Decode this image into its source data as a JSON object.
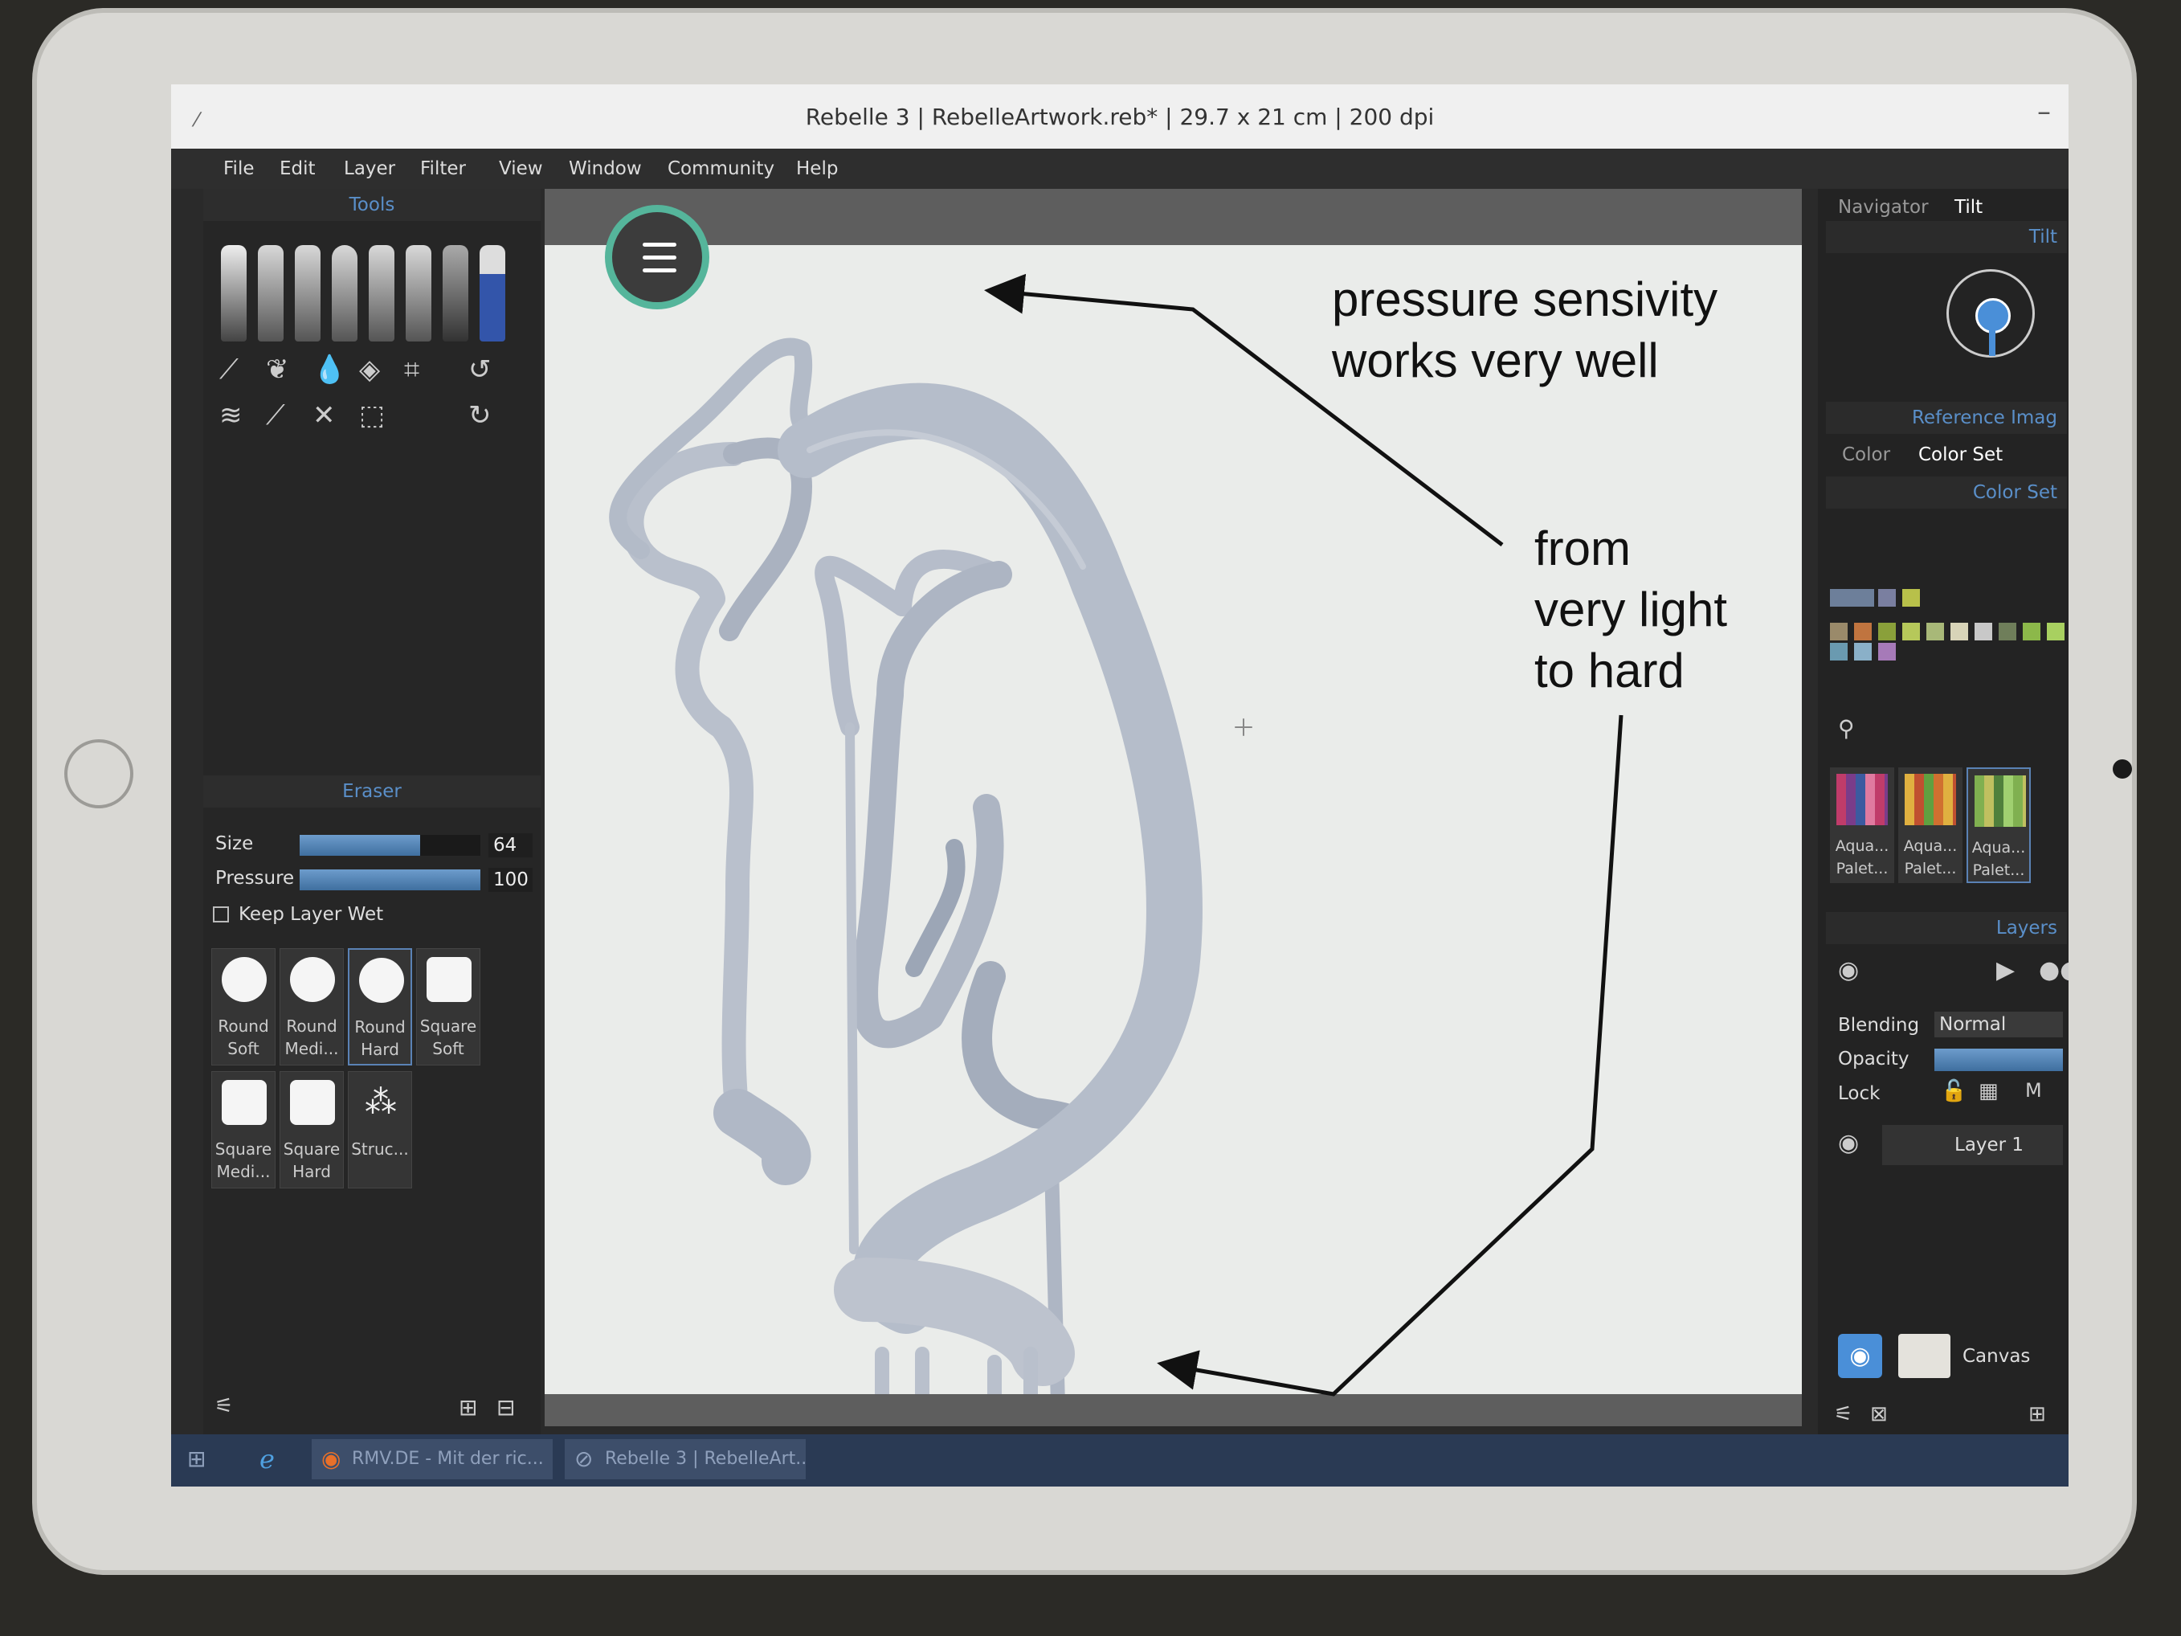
{
  "window": {
    "title": "Rebelle 3 | RebelleArtwork.reb* | 29.7 x 21 cm | 200 dpi",
    "minimize": "–"
  },
  "menu": [
    "File",
    "Edit",
    "Layer",
    "Filter",
    "View",
    "Window",
    "Community",
    "Help"
  ],
  "tools_panel": {
    "title": "Tools"
  },
  "eraser_panel": {
    "title": "Eraser",
    "size_label": "Size",
    "size_value": "64",
    "pressure_label": "Pressure",
    "pressure_value": "100",
    "keep_wet_label": "Keep Layer Wet",
    "presets": [
      {
        "line1": "Round",
        "line2": "Soft"
      },
      {
        "line1": "Round",
        "line2": "Medi..."
      },
      {
        "line1": "Round",
        "line2": "Hard"
      },
      {
        "line1": "Square",
        "line2": "Soft"
      },
      {
        "line1": "Square",
        "line2": "Medi..."
      },
      {
        "line1": "Square",
        "line2": "Hard"
      },
      {
        "line1": "Struc...",
        "line2": ""
      }
    ]
  },
  "right_panel": {
    "tab_navigator": "Navigator",
    "tab_tilt": "Tilt",
    "tilt_title": "Tilt",
    "reference_title": "Reference Imag",
    "tab_color": "Color",
    "tab_color_set": "Color Set",
    "color_set_title": "Color Set",
    "palettes": [
      {
        "line1": "Aqua...",
        "line2": "Palet..."
      },
      {
        "line1": "Aqua...",
        "line2": "Palet..."
      },
      {
        "line1": "Aqua...",
        "line2": "Palet..."
      }
    ],
    "layers_title": "Layers",
    "blending_label": "Blending",
    "blending_value": "Normal",
    "opacity_label": "Opacity",
    "lock_label": "Lock",
    "layer_name": "Layer 1",
    "canvas_label": "Canvas",
    "swatch_colors": [
      "#6d7f9a",
      "#7a7fa0",
      "#b8c04a",
      "#9a8a6a",
      "#c0743f",
      "#8aa03a",
      "#b6c85a",
      "#a8b878",
      "#d8d4b8",
      "#c8c8c8",
      "#6f7e5a",
      "#8cb84a",
      "#a8d060",
      "#6a9ab0",
      "#8ab0c8",
      "#a67ab8"
    ]
  },
  "taskbar": {
    "firefox_label": "RMV.DE - Mit der ric...",
    "rebelle_label": "Rebelle 3 | RebelleArt..."
  },
  "annotations": {
    "top_line1": "pressure sensivity",
    "top_line2": "works very well",
    "mid_line1": "from",
    "mid_line2": "very light",
    "mid_line3": "to hard"
  }
}
